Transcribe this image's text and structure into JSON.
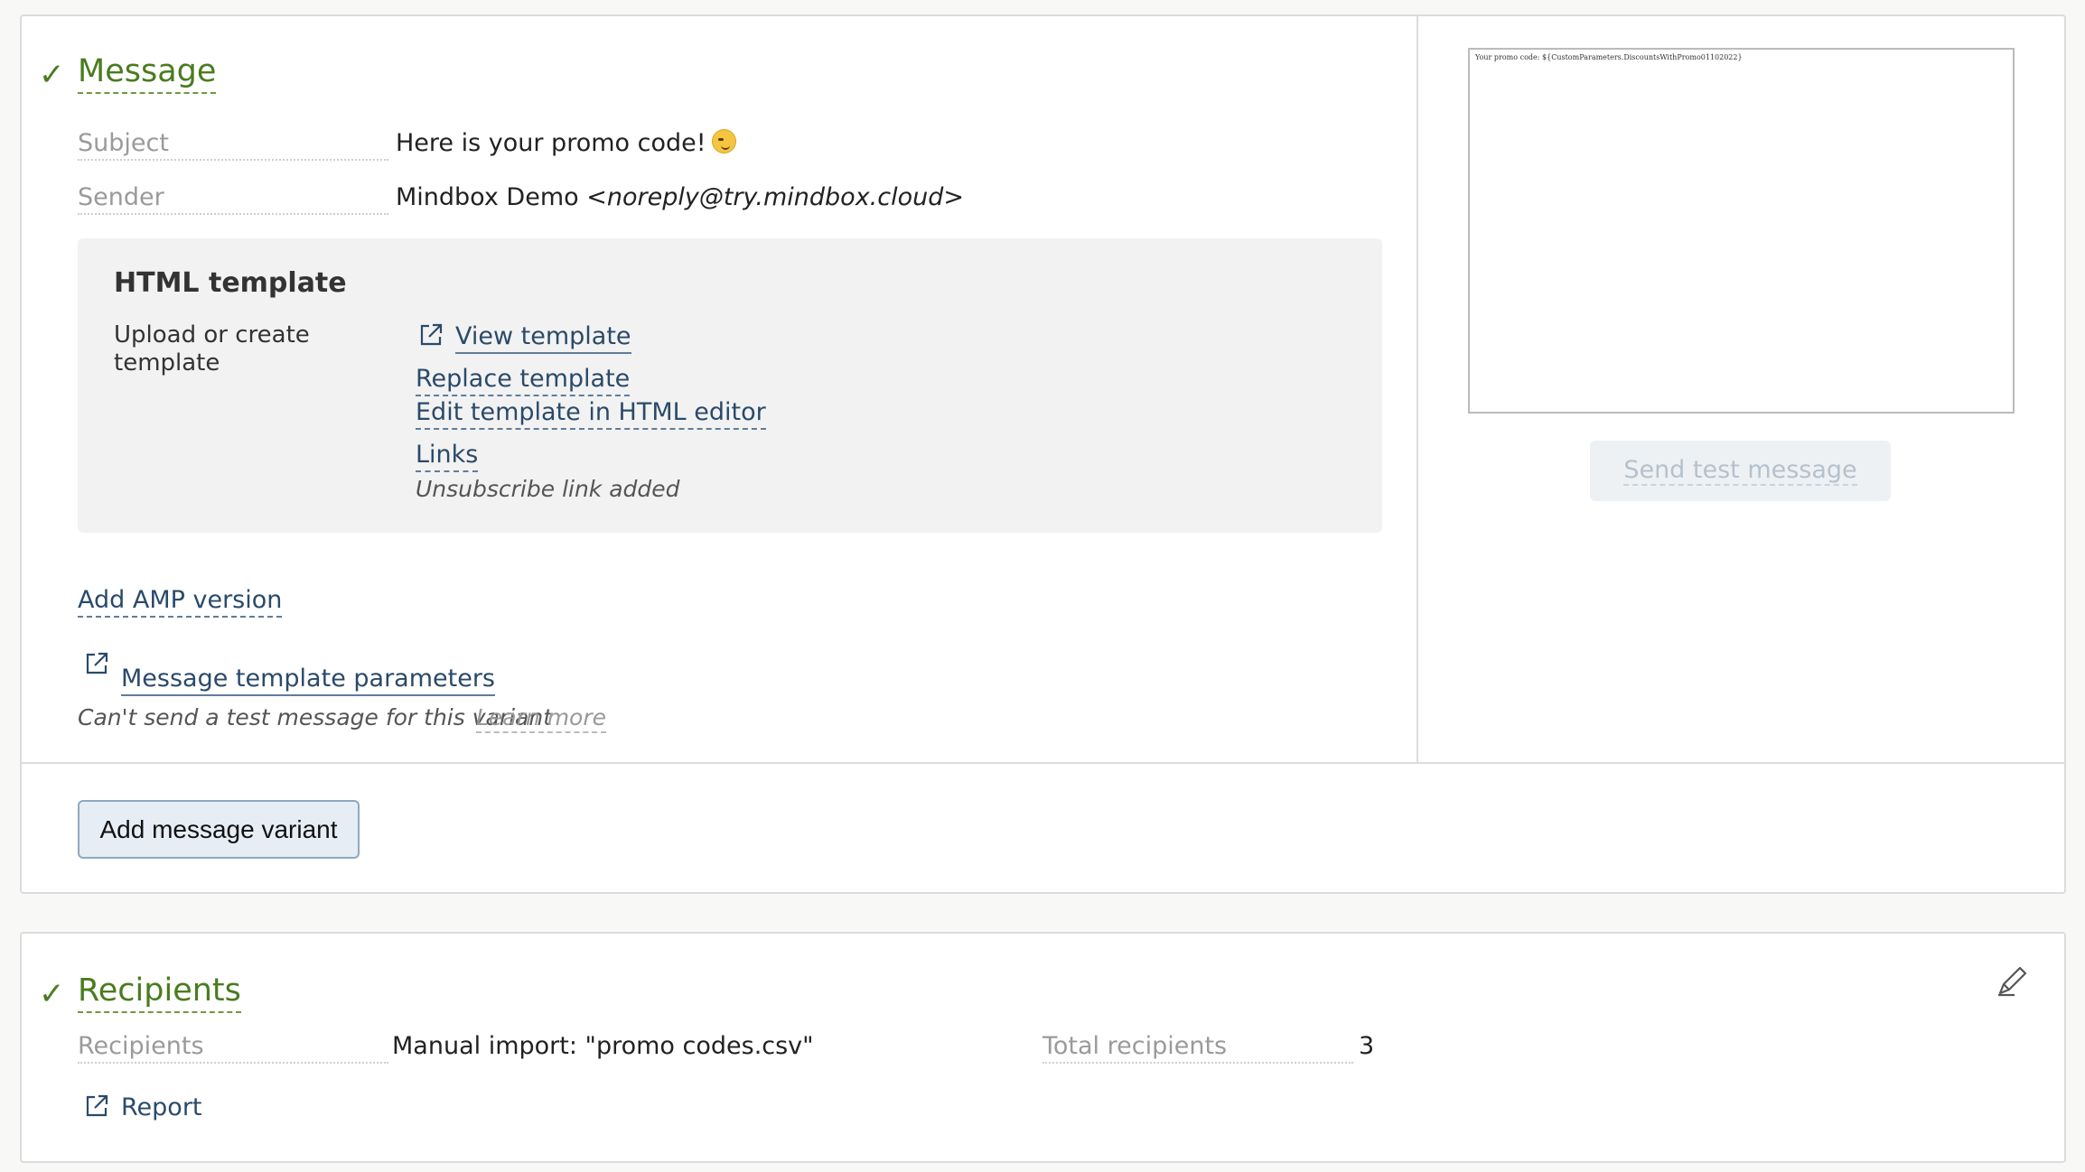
{
  "message_section": {
    "title": "Message",
    "check_icon": "checkmark-icon",
    "subject_label": "Subject",
    "subject_value": "Here is your promo code!",
    "subject_emoji": "winking-face-emoji",
    "sender_label": "Sender",
    "sender_name": "Mindbox Demo <",
    "sender_email": "noreply@try.mindbox.cloud",
    "sender_suffix": ">",
    "html_template": {
      "title": "HTML template",
      "label": "Upload or create template",
      "view_link": "View template",
      "replace_link": "Replace template",
      "edit_link": "Edit template in HTML editor",
      "links_link": "Links",
      "unsubscribe_note": "Unsubscribe link added"
    },
    "add_amp_link": "Add AMP version",
    "template_params_link": "Message template parameters",
    "cannot_send_note": "Can't send a test message for this variant",
    "learn_more_link": "Learn more",
    "preview_text": "Your promo code: ${CustomParameters.DiscountsWithPromo01102022}",
    "send_test_button": "Send test message",
    "add_variant_button": "Add message variant"
  },
  "recipients_section": {
    "title": "Recipients",
    "check_icon": "checkmark-icon",
    "edit_icon": "pencil-edit-icon",
    "recipients_label": "Recipients",
    "recipients_value": "Manual import: \"promo codes.csv\"",
    "total_label": "Total recipients",
    "total_value": "3",
    "report_link": "Report"
  },
  "colors": {
    "accent_green": "#4a7c1f",
    "link_blue": "#2a4a6a",
    "panel_border": "#dcdcdc",
    "template_bg": "#f2f2f2"
  }
}
